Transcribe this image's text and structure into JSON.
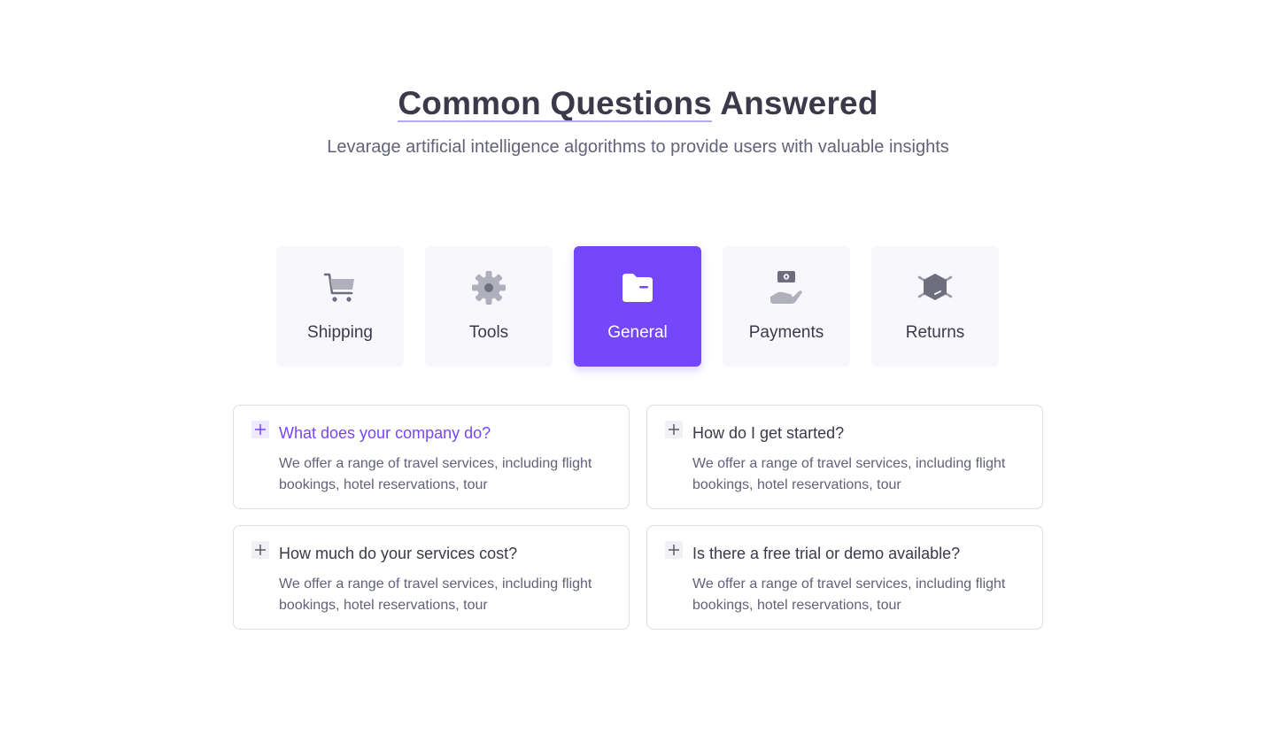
{
  "header": {
    "title_highlight": "Common Questions",
    "title_rest": "Answered",
    "subtitle": "Levarage artificial intelligence algorithms to provide users with valuable insights"
  },
  "tabs": [
    {
      "label": "Shipping",
      "icon": "cart-icon",
      "active": false
    },
    {
      "label": "Tools",
      "icon": "gear-icon",
      "active": false
    },
    {
      "label": "General",
      "icon": "folder-icon",
      "active": true
    },
    {
      "label": "Payments",
      "icon": "hand-money-icon",
      "active": false
    },
    {
      "label": "Returns",
      "icon": "box-return-icon",
      "active": false
    }
  ],
  "faq": [
    {
      "question": "What does your company do?",
      "answer": "We offer a range of travel services, including flight bookings, hotel reservations, tour",
      "open": true
    },
    {
      "question": "How do I get started?",
      "answer": "We offer a range of travel services, including flight bookings, hotel reservations, tour",
      "open": false
    },
    {
      "question": "How much do your services cost?",
      "answer": "We offer a range of travel services, including flight bookings, hotel reservations, tour",
      "open": false
    },
    {
      "question": "Is there a free trial or demo available?",
      "answer": "We offer a range of travel services, including flight bookings, hotel reservations, tour",
      "open": false
    }
  ],
  "colors": {
    "accent": "#7547fb",
    "tab_bg": "#f7f7fc",
    "icon_gray": "#9a9aa8",
    "icon_dark": "#6e6e7e"
  }
}
